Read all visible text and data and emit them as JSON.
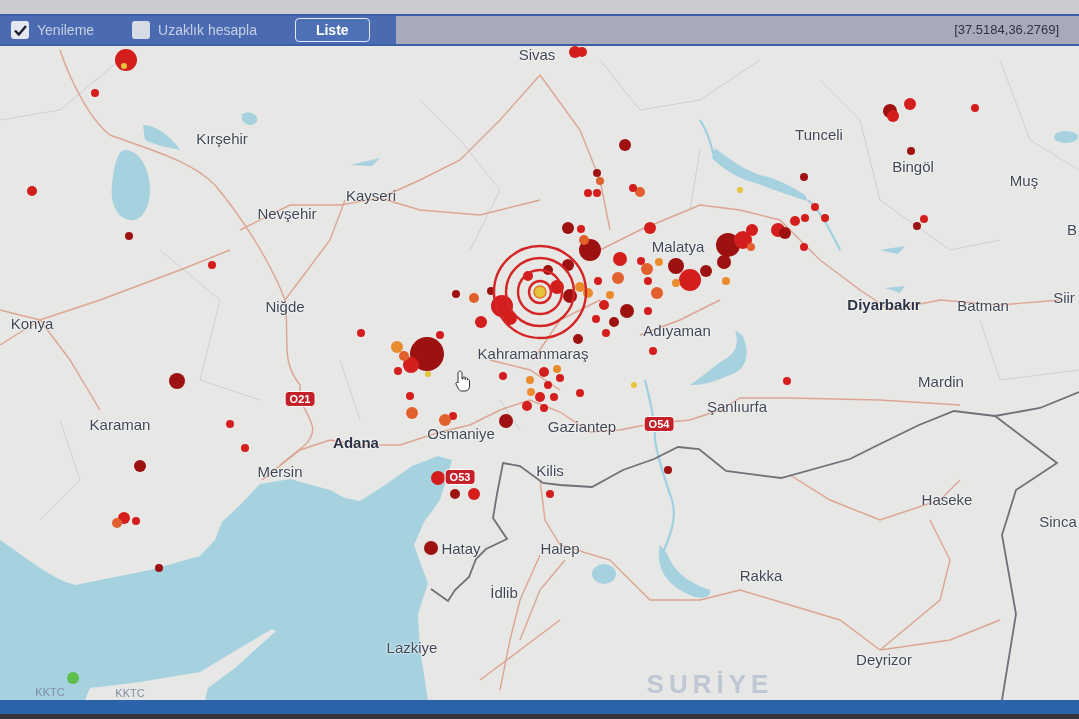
{
  "toolbar": {
    "checkboxes": [
      {
        "label": "Yenileme",
        "checked": true
      },
      {
        "label": "Uzaklık hesapla",
        "checked": false
      }
    ],
    "button": "Liste",
    "coordinates": "[37.5184,36.2769]"
  },
  "map": {
    "labels": [
      {
        "text": "Sivas",
        "kind": "city"
      },
      {
        "text": "Kırşehir",
        "kind": "city"
      },
      {
        "text": "Tunceli",
        "kind": "city"
      },
      {
        "text": "Bingöl",
        "kind": "city"
      },
      {
        "text": "Muş",
        "kind": "city"
      },
      {
        "text": "Kayseri",
        "kind": "city"
      },
      {
        "text": "Nevşehir",
        "kind": "city"
      },
      {
        "text": "B",
        "kind": "city"
      },
      {
        "text": "Malatya",
        "kind": "city"
      },
      {
        "text": "Niğde",
        "kind": "city"
      },
      {
        "text": "Diyarbakır",
        "kind": "major"
      },
      {
        "text": "Batman",
        "kind": "city"
      },
      {
        "text": "Siir",
        "kind": "city"
      },
      {
        "text": "Konya",
        "kind": "city"
      },
      {
        "text": "Adıyaman",
        "kind": "city"
      },
      {
        "text": "Kahramanmaraş",
        "kind": "city"
      },
      {
        "text": "Mardin",
        "kind": "city"
      },
      {
        "text": "O21",
        "kind": "road"
      },
      {
        "text": "Şanlıurfa",
        "kind": "city"
      },
      {
        "text": "Karaman",
        "kind": "city"
      },
      {
        "text": "Adana",
        "kind": "major"
      },
      {
        "text": "Osmaniye",
        "kind": "city"
      },
      {
        "text": "Gaziantep",
        "kind": "city"
      },
      {
        "text": "O54",
        "kind": "road"
      },
      {
        "text": "Mersin",
        "kind": "city"
      },
      {
        "text": "O53",
        "kind": "road"
      },
      {
        "text": "Kilis",
        "kind": "city"
      },
      {
        "text": "Haseke",
        "kind": "city"
      },
      {
        "text": "Sinca",
        "kind": "city"
      },
      {
        "text": "Hatay",
        "kind": "city"
      },
      {
        "text": "Halep",
        "kind": "city"
      },
      {
        "text": "Rakka",
        "kind": "city"
      },
      {
        "text": "İdlib",
        "kind": "city"
      },
      {
        "text": "Lazkiye",
        "kind": "city"
      },
      {
        "text": "Deyrizor",
        "kind": "city"
      },
      {
        "text": "KKTC",
        "kind": "territory"
      },
      {
        "text": "KKTC",
        "kind": "territory"
      },
      {
        "text": "SURİYE",
        "kind": "country"
      }
    ],
    "markers": [
      {
        "color": "#d41d1d"
      },
      {
        "color": "#e5c33b"
      },
      {
        "color": "#d41d1d"
      },
      {
        "color": "#d41d1d"
      },
      {
        "color": "#9e1111"
      },
      {
        "color": "#d41d1d"
      },
      {
        "color": "#9e1111"
      },
      {
        "color": "#d41d1d"
      },
      {
        "color": "#d41d1d"
      },
      {
        "color": "#9e1111"
      },
      {
        "color": "#d41d1d"
      },
      {
        "color": "#e2602e"
      },
      {
        "color": "#d41d1d"
      },
      {
        "color": "#9e1111"
      },
      {
        "color": "#5cbf4a"
      },
      {
        "color": "#9e1111"
      },
      {
        "color": "#d41d1d"
      },
      {
        "color": "#ea8b2d"
      },
      {
        "color": "#e2602e"
      },
      {
        "color": "#d41d1d"
      },
      {
        "color": "#e5c33b"
      },
      {
        "color": "#d41d1d"
      },
      {
        "color": "#d41d1d"
      },
      {
        "color": "#9e1111"
      },
      {
        "color": "#e2602e"
      },
      {
        "color": "#d41d1d"
      },
      {
        "color": "#9e1111"
      },
      {
        "color": "#d41d1d"
      },
      {
        "color": "#d41d1d"
      },
      {
        "color": "#d41d1d"
      },
      {
        "color": "#9e1111"
      },
      {
        "color": "#d41d1d"
      },
      {
        "color": "#9e1111"
      },
      {
        "color": "#9e1111"
      },
      {
        "color": "#ea8b2d"
      },
      {
        "color": "#9e1111"
      },
      {
        "color": "#9e1111"
      },
      {
        "color": "#d41d1d"
      },
      {
        "color": "#ea8b2d"
      },
      {
        "color": "#d41d1d"
      },
      {
        "color": "#ea8b2d"
      },
      {
        "color": "#d41d1d"
      },
      {
        "color": "#d41d1d"
      },
      {
        "color": "#9e1111"
      },
      {
        "color": "#9e1111"
      },
      {
        "color": "#d41d1d"
      },
      {
        "color": "#e2602e"
      },
      {
        "color": "#d41d1d"
      },
      {
        "color": "#e2602e"
      },
      {
        "color": "#ea8b2d"
      },
      {
        "color": "#9e1111"
      },
      {
        "color": "#d41d1d"
      },
      {
        "color": "#e2602e"
      },
      {
        "color": "#d41d1d"
      },
      {
        "color": "#d41d1d"
      },
      {
        "color": "#d41d1d"
      },
      {
        "color": "#9e1111"
      },
      {
        "color": "#ea8b2d"
      },
      {
        "color": "#9e1111"
      },
      {
        "color": "#d41d1d"
      },
      {
        "color": "#d41d1d"
      },
      {
        "color": "#9e1111"
      },
      {
        "color": "#e2602e"
      },
      {
        "color": "#ea8b2d"
      },
      {
        "color": "#d41d1d"
      },
      {
        "color": "#9e1111"
      },
      {
        "color": "#d41d1d"
      },
      {
        "color": "#d41d1d"
      },
      {
        "color": "#d41d1d"
      },
      {
        "color": "#d41d1d"
      },
      {
        "color": "#d41d1d"
      },
      {
        "color": "#e5c33b"
      },
      {
        "color": "#9e1111"
      },
      {
        "color": "#9e1111"
      },
      {
        "color": "#d41d1d"
      },
      {
        "color": "#d41d1d"
      },
      {
        "color": "#d41d1d"
      },
      {
        "color": "#9e1111"
      },
      {
        "color": "#d41d1d"
      },
      {
        "color": "#9e1111"
      },
      {
        "color": "#d41d1d"
      },
      {
        "color": "#e5c33b"
      },
      {
        "color": "#d41d1d"
      },
      {
        "color": "#9e1111"
      },
      {
        "color": "#9e1111"
      },
      {
        "color": "#e2602e"
      },
      {
        "color": "#d41d1d"
      },
      {
        "color": "#d41d1d"
      },
      {
        "color": "#e2602e"
      },
      {
        "color": "#d41d1d"
      },
      {
        "color": "#d41d1d"
      },
      {
        "color": "#ea8b2d"
      },
      {
        "color": "#d41d1d"
      },
      {
        "color": "#d41d1d"
      },
      {
        "color": "#ea8b2d"
      },
      {
        "color": "#d41d1d"
      },
      {
        "color": "#ea8b2d"
      },
      {
        "color": "#d41d1d"
      },
      {
        "color": "#d41d1d"
      },
      {
        "color": "#d41d1d"
      },
      {
        "color": "#d41d1d"
      },
      {
        "color": "#d41d1d"
      },
      {
        "color": "#9e1111"
      },
      {
        "color": "#d41d1d"
      },
      {
        "color": "#d41d1d"
      },
      {
        "color": "#e2602e"
      },
      {
        "color": "#e2602e"
      },
      {
        "color": "#d41d1d"
      },
      {
        "color": "#9e1111"
      },
      {
        "color": "#d41d1d"
      },
      {
        "color": "#9e1111"
      },
      {
        "color": "#d41d1d"
      },
      {
        "color": "#9e1111"
      },
      {
        "color": "#9e1111"
      },
      {
        "color": "#d41d1d"
      },
      {
        "color": "#d41d1d"
      },
      {
        "color": "#e2602e"
      },
      {
        "color": "#d41d1d"
      }
    ]
  }
}
